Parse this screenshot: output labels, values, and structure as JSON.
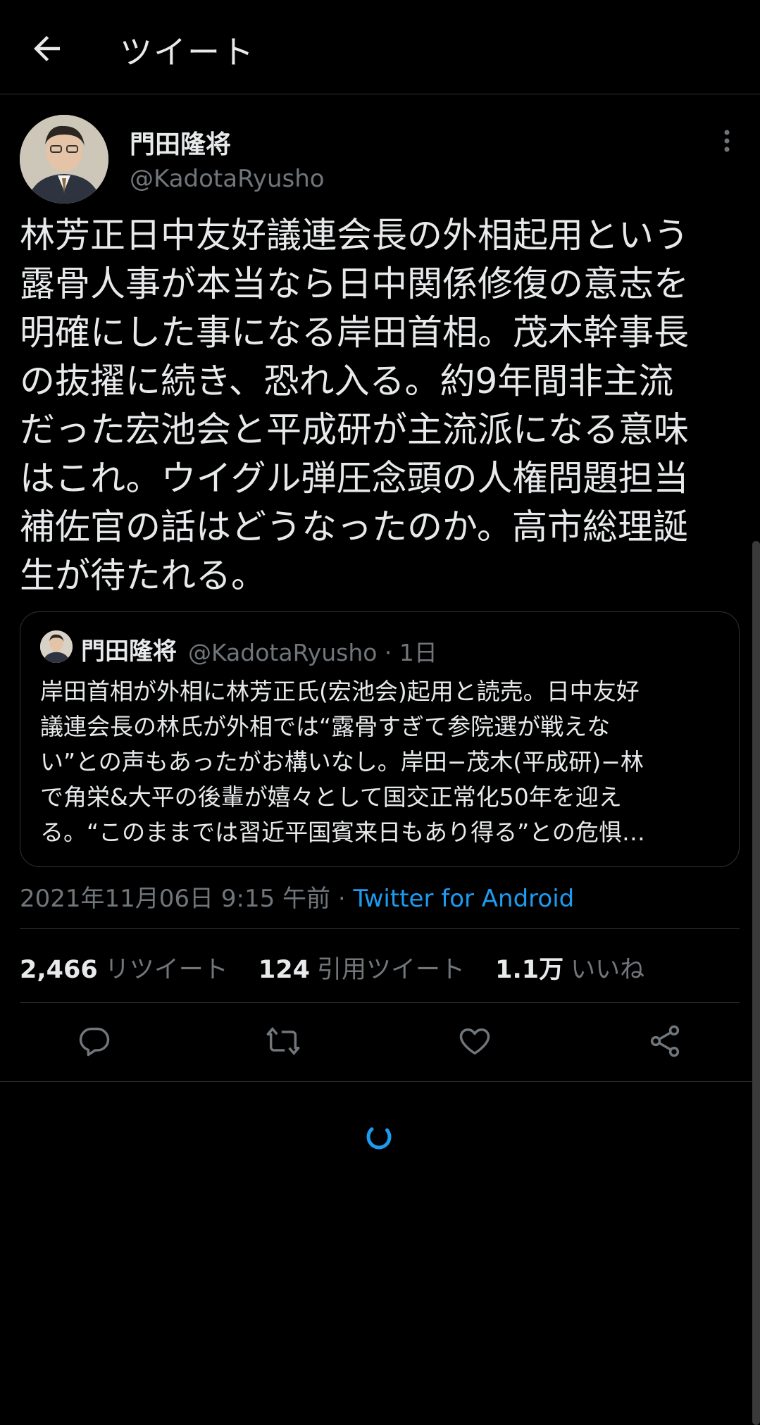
{
  "header": {
    "title": "ツイート",
    "back_icon": "arrow-left-icon"
  },
  "tweet": {
    "author_name": "門田隆将",
    "author_handle": "@KadotaRyusho",
    "text": "林芳正日中友好議連会長の外相起用という\n露骨人事が本当なら日中関係修復の意志を\n明確にした事になる岸田首相。茂木幹事長\nの抜擢に続き、恐れ入る。約9年間非主流\nだった宏池会と平成研が主流派になる意味\nはこれ。ウイグル弾圧念頭の人権問題担当\n補佐官の話はどうなったのか。高市総理誕\n生が待たれる。",
    "timestamp": "2021年11月06日 9:15 午前",
    "separator": "·",
    "source": "Twitter for Android"
  },
  "quoted_tweet": {
    "author_name": "門田隆将",
    "meta": "@KadotaRyusho · 1日",
    "text": "岸田首相が外相に林芳正氏(宏池会)起用と読売。日中友好\n議連会長の林氏が外相では“露骨すぎて参院選が戦えな\nい”との声もあったがお構いなし。岸田−茂木(平成研)−林\nで角栄&大平の後輩が嬉々として国交正常化50年を迎え\nる。“このままでは習近平国賓来日もあり得る”との危惧…"
  },
  "stats": {
    "retweets_count": "2,466",
    "retweets_label": "リツイート",
    "quotes_count": "124",
    "quotes_label": "引用ツイート",
    "likes_count": "1.1万",
    "likes_label": "いいね"
  },
  "actions": [
    "reply-icon",
    "retweet-icon",
    "like-icon",
    "share-icon"
  ],
  "colors": {
    "background": "#000000",
    "text": "#e7e9ea",
    "muted": "#71767b",
    "link": "#1d9bf0",
    "border": "#2f3336"
  }
}
